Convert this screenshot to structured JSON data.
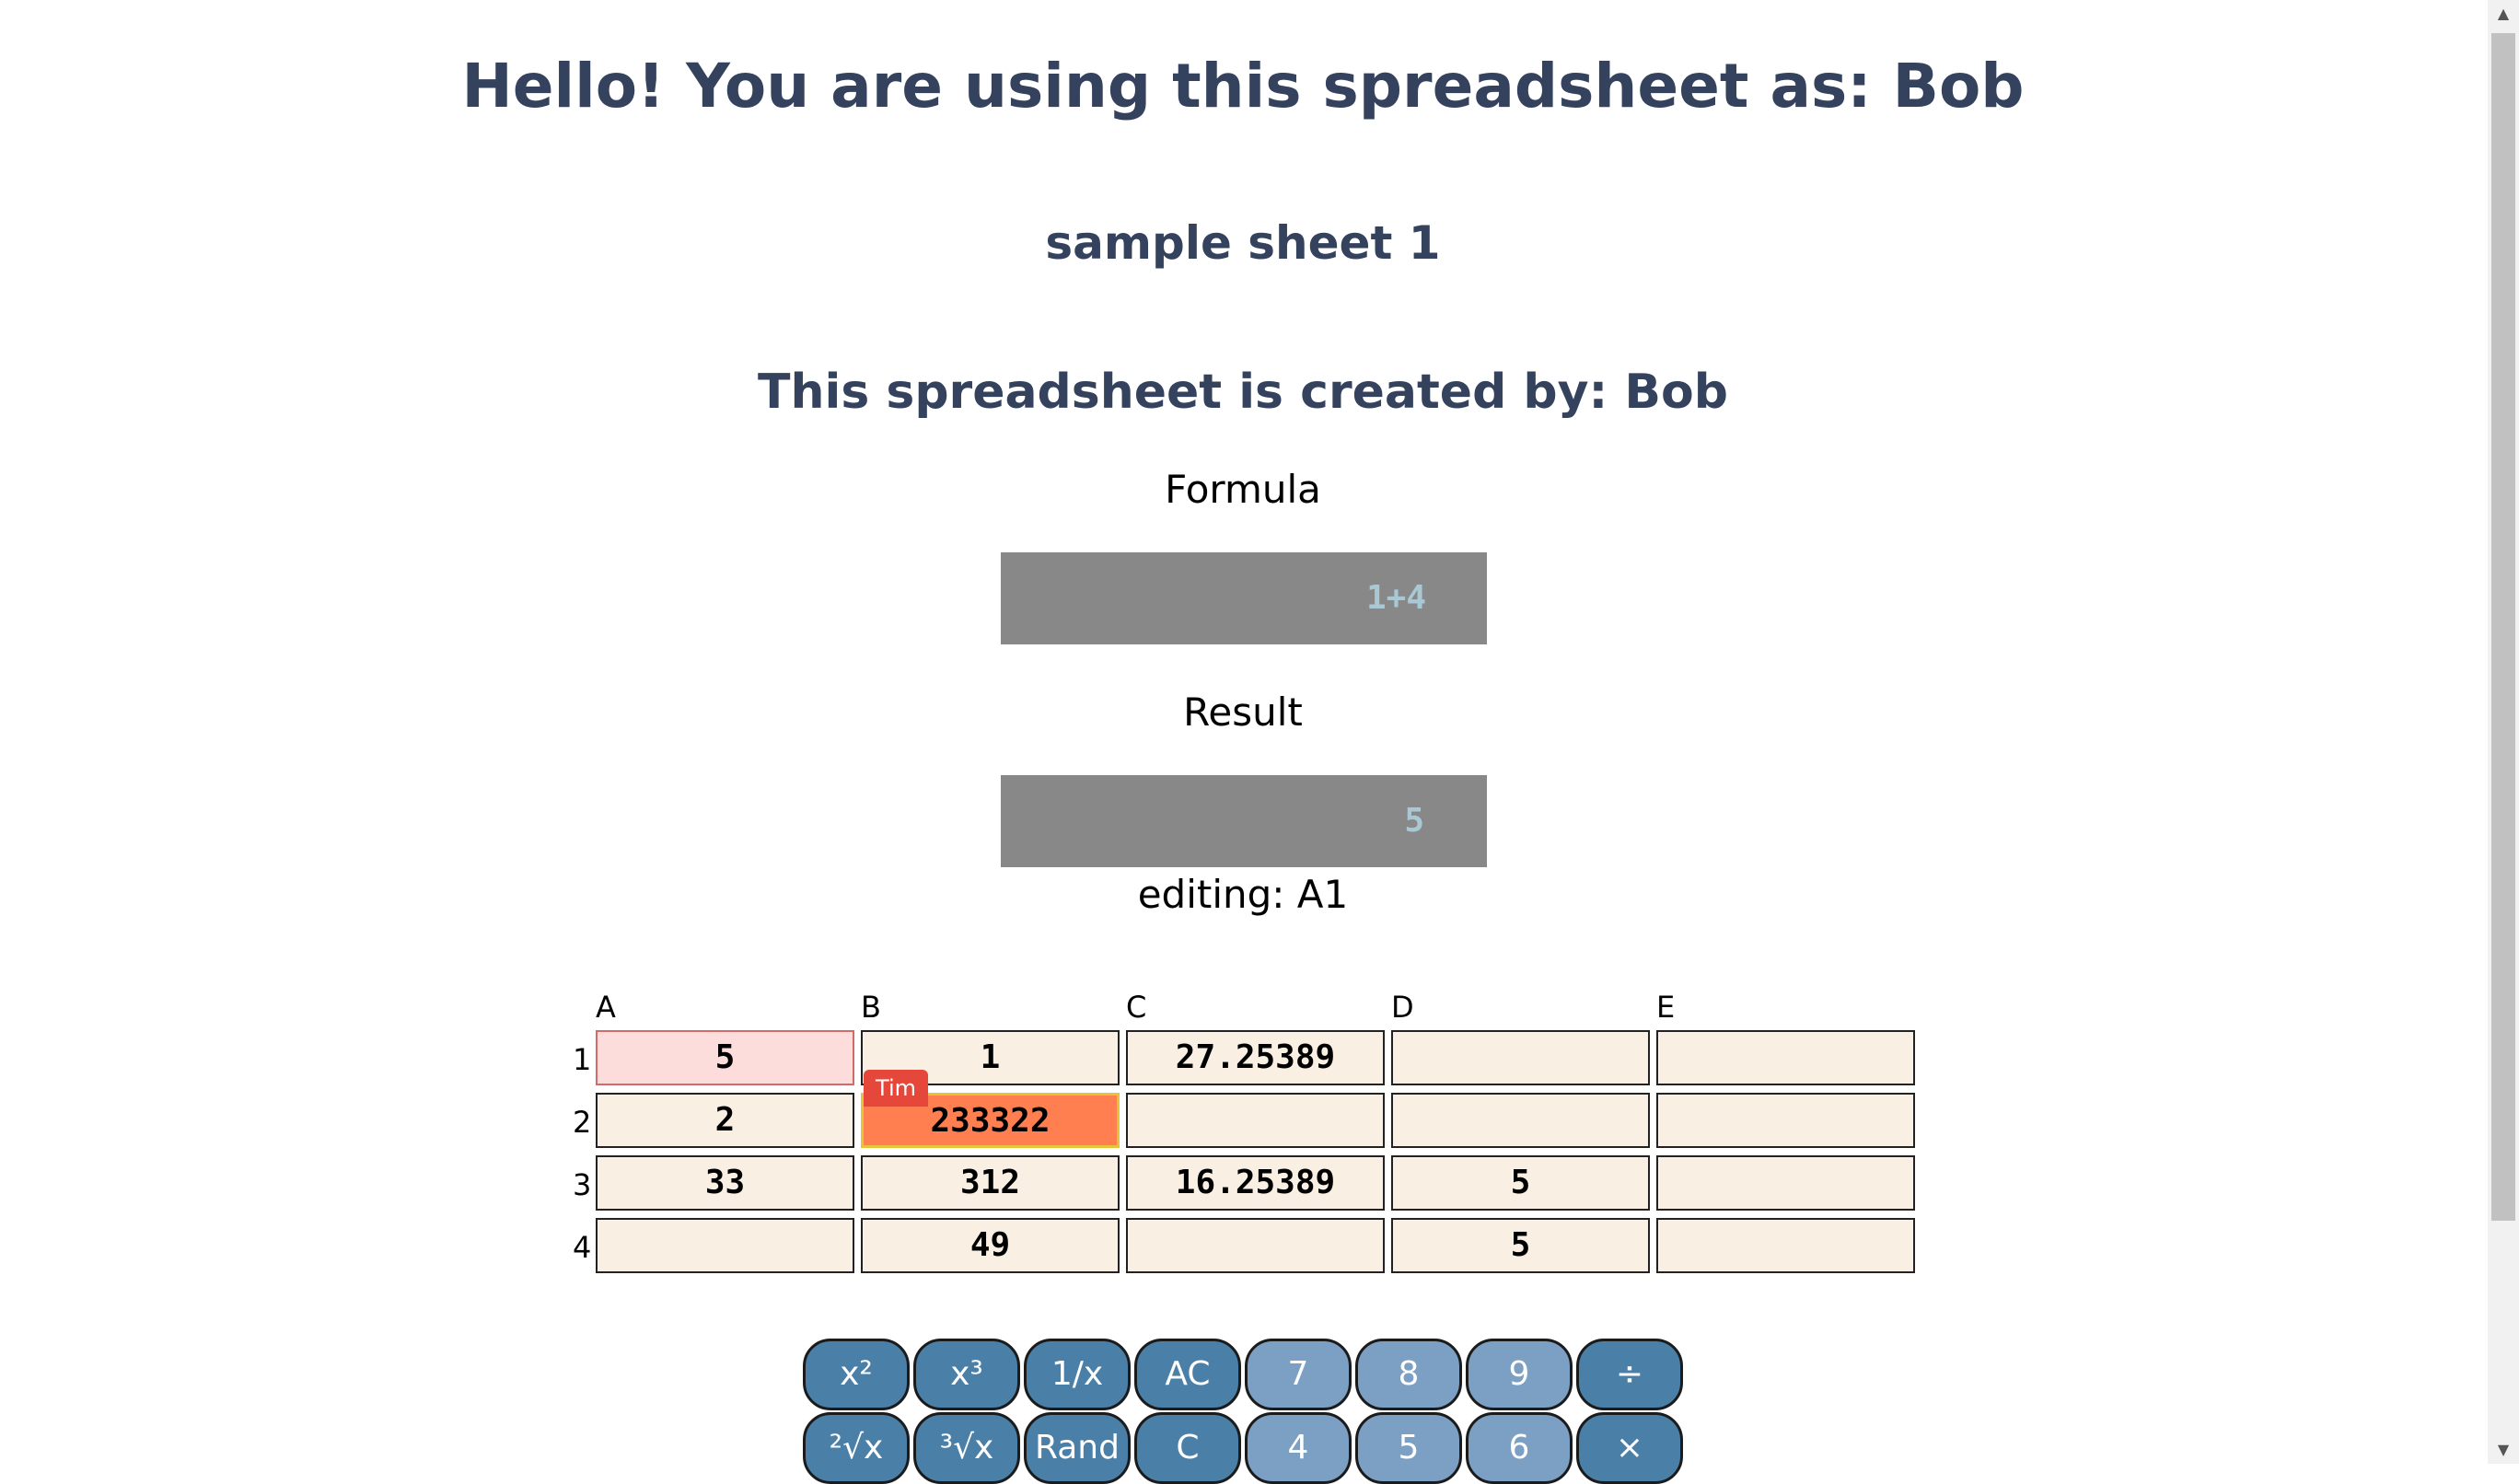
{
  "header": {
    "greeting": "Hello! You are using this spreadsheet as: Bob",
    "sheet_name": "sample sheet 1",
    "creator": "This spreadsheet is created by: Bob"
  },
  "formula": {
    "label": "Formula",
    "value": "1+4"
  },
  "result": {
    "label": "Result",
    "value": "5"
  },
  "editing": "editing: A1",
  "grid": {
    "columns": [
      "A",
      "B",
      "C",
      "D",
      "E"
    ],
    "rows": [
      "1",
      "2",
      "3",
      "4"
    ],
    "cells": [
      [
        "5",
        "1",
        "27.25389",
        "",
        ""
      ],
      [
        "2",
        "233322",
        "",
        "",
        ""
      ],
      [
        "33",
        "312",
        "16.25389",
        "5",
        ""
      ],
      [
        "",
        "49",
        "",
        "5",
        ""
      ]
    ],
    "selected_cell": "A1",
    "peer": {
      "name": "Tim",
      "cell": "B2"
    }
  },
  "keypad": {
    "row1": [
      "x²",
      "x³",
      "1/x",
      "AC",
      "7",
      "8",
      "9",
      "÷"
    ],
    "row2": [
      "²√x",
      "³√x",
      "Rand",
      "C",
      "4",
      "5",
      "6",
      "×"
    ]
  },
  "colors": {
    "title": "#34425e",
    "display_bg": "#888888",
    "display_text": "#a8c8d4",
    "cell_bg": "#faefe3",
    "selected_bg": "#fddcdc",
    "peer_bg": "#ff7f50",
    "peer_tag": "#e5483a",
    "key_function": "#4a7fa8",
    "key_number": "#7c9fc4"
  }
}
